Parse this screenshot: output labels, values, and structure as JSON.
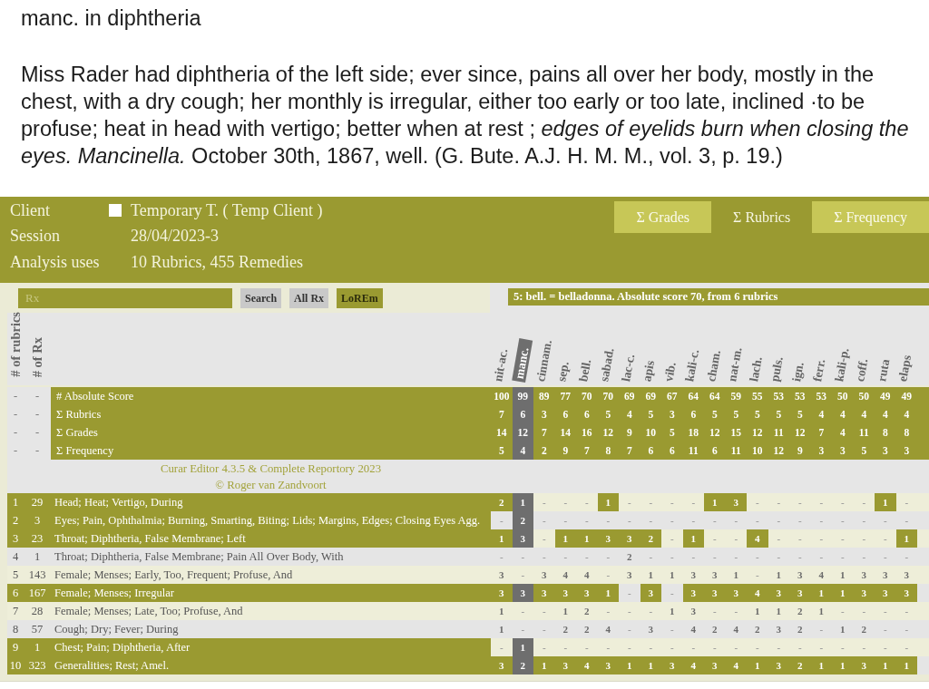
{
  "note": {
    "title": "manc. in diphtheria",
    "text": "Miss Rader had diphtheria of the left side; ever since, pains all over her body, mostly in the chest, with a dry cough; her monthly is irregular, either too early or too late, inclined ·to be profuse; heat in head with vertigo; better when at rest ; *edges of eyelids burn when closing the eyes. Mancinella.* October 30th, 1867, well. (G. Bute. A.J. H. M. M., vol. 3, p. 19.)"
  },
  "app": {
    "client": {
      "label": "Client",
      "checked": false,
      "value": "Temporary T. ( Temp Client )"
    },
    "session": {
      "label": "Session",
      "value": "28/04/2023-3"
    },
    "analysis": {
      "label": "Analysis uses",
      "value": "10 Rubrics, 455 Remedies"
    },
    "sort_tabs": [
      {
        "label": "Σ Grades",
        "selected": false
      },
      {
        "label": "Σ Rubrics",
        "selected": true
      },
      {
        "label": "Σ Frequency",
        "selected": false
      }
    ],
    "toolbar": {
      "search": {
        "placeholder": "Rx"
      },
      "buttons": [
        {
          "label": "Search",
          "active": false
        },
        {
          "label": "All Rx",
          "active": false
        },
        {
          "label": "LoREm",
          "active": true
        }
      ],
      "info": "5: bell. = belladonna. Absolute score 70, from 6 rubrics"
    },
    "grid": {
      "count_headers": [
        "# of rubrics",
        "# of Rx"
      ],
      "remedies": [
        {
          "name": "nit-ac.",
          "selected": false
        },
        {
          "name": "manc.",
          "selected": true
        },
        {
          "name": "cinnam.",
          "selected": false
        },
        {
          "name": "sep.",
          "selected": false
        },
        {
          "name": "bell.",
          "selected": false
        },
        {
          "name": "sabad.",
          "selected": false
        },
        {
          "name": "lac-c.",
          "selected": false
        },
        {
          "name": "apis",
          "selected": false
        },
        {
          "name": "vib.",
          "selected": false
        },
        {
          "name": "kali-c.",
          "selected": false
        },
        {
          "name": "cham.",
          "selected": false
        },
        {
          "name": "nat-m.",
          "selected": false
        },
        {
          "name": "lach.",
          "selected": false
        },
        {
          "name": "puls.",
          "selected": false
        },
        {
          "name": "ign.",
          "selected": false
        },
        {
          "name": "ferr.",
          "selected": false
        },
        {
          "name": "kali-p.",
          "selected": false
        },
        {
          "name": "coff.",
          "selected": false
        },
        {
          "name": "ruta",
          "selected": false
        },
        {
          "name": "elaps",
          "selected": false
        }
      ],
      "score_rows": [
        {
          "count": "-",
          "rx": "-",
          "label": "# Absolute Score",
          "values": [
            "100",
            "99",
            "89",
            "77",
            "70",
            "70",
            "69",
            "69",
            "67",
            "64",
            "64",
            "59",
            "55",
            "53",
            "53",
            "53",
            "50",
            "50",
            "49",
            "49"
          ]
        },
        {
          "count": "-",
          "rx": "-",
          "label": "Σ Rubrics",
          "values": [
            "7",
            "6",
            "3",
            "6",
            "6",
            "5",
            "4",
            "5",
            "3",
            "6",
            "5",
            "5",
            "5",
            "5",
            "5",
            "4",
            "4",
            "4",
            "4",
            "4"
          ]
        },
        {
          "count": "-",
          "rx": "-",
          "label": "Σ Grades",
          "values": [
            "14",
            "12",
            "7",
            "14",
            "16",
            "12",
            "9",
            "10",
            "5",
            "18",
            "12",
            "15",
            "12",
            "11",
            "12",
            "7",
            "4",
            "11",
            "8",
            "8"
          ]
        },
        {
          "count": "-",
          "rx": "-",
          "label": "Σ Frequency",
          "values": [
            "5",
            "4",
            "2",
            "9",
            "7",
            "8",
            "7",
            "6",
            "6",
            "11",
            "6",
            "11",
            "10",
            "12",
            "9",
            "3",
            "3",
            "5",
            "3",
            "3"
          ]
        }
      ],
      "credits": [
        "Curar Editor 4.3.5 & Complete Reportory 2023",
        "© Roger van Zandvoort"
      ],
      "rubrics": [
        {
          "number": "1",
          "rx": "29",
          "label": "Head; Heat; Vertigo, During",
          "highlighted": true,
          "values": [
            "2",
            "1",
            "-",
            "-",
            "-",
            "1",
            "-",
            "-",
            "-",
            "-",
            "1",
            "3",
            "-",
            "-",
            "-",
            "-",
            "-",
            "-",
            "1",
            "-"
          ]
        },
        {
          "number": "2",
          "rx": "3",
          "label": "Eyes; Pain, Ophthalmia; Burning, Smarting, Biting; Lids; Margins, Edges; Closing Eyes Agg.",
          "highlighted": true,
          "values": [
            "-",
            "2",
            "-",
            "-",
            "-",
            "-",
            "-",
            "-",
            "-",
            "-",
            "-",
            "-",
            "-",
            "-",
            "-",
            "-",
            "-",
            "-",
            "-",
            "-"
          ]
        },
        {
          "number": "3",
          "rx": "23",
          "label": "Throat; Diphtheria, False Membrane; Left",
          "highlighted": true,
          "values": [
            "1",
            "3",
            "-",
            "1",
            "1",
            "3",
            "3",
            "2",
            "-",
            "1",
            "-",
            "-",
            "4",
            "-",
            "-",
            "-",
            "-",
            "-",
            "-",
            "1"
          ]
        },
        {
          "number": "4",
          "rx": "1",
          "label": "Throat; Diphtheria, False Membrane; Pain All Over Body, With",
          "highlighted": false,
          "values": [
            "-",
            "-",
            "-",
            "-",
            "-",
            "-",
            "2",
            "-",
            "-",
            "-",
            "-",
            "-",
            "-",
            "-",
            "-",
            "-",
            "-",
            "-",
            "-",
            "-"
          ]
        },
        {
          "number": "5",
          "rx": "143",
          "label": "Female; Menses; Early, Too, Frequent; Profuse, And",
          "highlighted": false,
          "values": [
            "3",
            "-",
            "3",
            "4",
            "4",
            "-",
            "3",
            "1",
            "1",
            "3",
            "3",
            "1",
            "-",
            "1",
            "3",
            "4",
            "1",
            "3",
            "3",
            "3"
          ]
        },
        {
          "number": "6",
          "rx": "167",
          "label": "Female; Menses; Irregular",
          "highlighted": true,
          "values": [
            "3",
            "3",
            "3",
            "3",
            "3",
            "1",
            "-",
            "3",
            "-",
            "3",
            "3",
            "3",
            "4",
            "3",
            "3",
            "1",
            "1",
            "3",
            "3",
            "3"
          ]
        },
        {
          "number": "7",
          "rx": "28",
          "label": "Female; Menses; Late, Too; Profuse, And",
          "highlighted": false,
          "values": [
            "1",
            "-",
            "-",
            "1",
            "2",
            "-",
            "-",
            "-",
            "1",
            "3",
            "-",
            "-",
            "1",
            "1",
            "2",
            "1",
            "-",
            "-",
            "-",
            "-"
          ]
        },
        {
          "number": "8",
          "rx": "57",
          "label": "Cough; Dry; Fever; During",
          "highlighted": false,
          "values": [
            "1",
            "-",
            "-",
            "2",
            "2",
            "4",
            "-",
            "3",
            "-",
            "4",
            "2",
            "4",
            "2",
            "3",
            "2",
            "-",
            "1",
            "2",
            "-",
            "-"
          ]
        },
        {
          "number": "9",
          "rx": "1",
          "label": "Chest; Pain; Diphtheria, After",
          "highlighted": true,
          "values": [
            "-",
            "1",
            "-",
            "-",
            "-",
            "-",
            "-",
            "-",
            "-",
            "-",
            "-",
            "-",
            "-",
            "-",
            "-",
            "-",
            "-",
            "-",
            "-",
            "-"
          ]
        },
        {
          "number": "10",
          "rx": "323",
          "label": "Generalities; Rest; Amel.",
          "highlighted": true,
          "values": [
            "3",
            "2",
            "1",
            "3",
            "4",
            "3",
            "1",
            "1",
            "3",
            "4",
            "3",
            "4",
            "1",
            "3",
            "2",
            "1",
            "1",
            "3",
            "1",
            "1"
          ]
        }
      ]
    }
  }
}
